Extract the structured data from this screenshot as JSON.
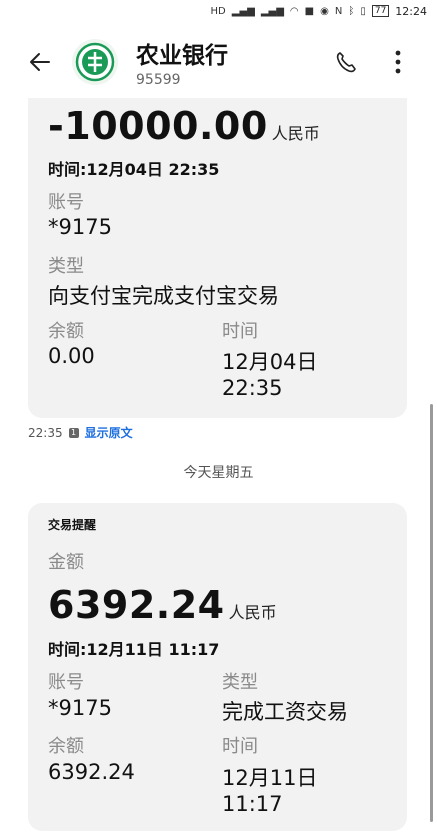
{
  "status_bar": {
    "time": "12:24",
    "battery": "77"
  },
  "header": {
    "title": "农业银行",
    "subtitle": "95599"
  },
  "messages": [
    {
      "amount": "-10000.00",
      "unit": "人民币",
      "time_line": "时间:12月04日 22:35",
      "account_label": "账号",
      "account_value": "*9175",
      "type_label": "类型",
      "type_value": "向支付宝完成支付宝交易",
      "balance_label": "余额",
      "balance_value": "0.00",
      "datetime_label": "时间",
      "datetime_line1": "12月04日",
      "datetime_line2": "22:35"
    },
    {
      "card_title": "交易提醒",
      "amount_label": "金额",
      "amount": "6392.24",
      "unit": "人民币",
      "time_line": "时间:12月11日 11:17",
      "account_label": "账号",
      "account_value": "*9175",
      "type_label": "类型",
      "type_value": "完成工资交易",
      "balance_label": "余额",
      "balance_value": "6392.24",
      "datetime_label": "时间",
      "datetime_line1": "12月11日",
      "datetime_line2": "11:17"
    }
  ],
  "message_meta": {
    "time": "22:35",
    "sim_badge": "1",
    "show_original": "显示原文"
  },
  "day_separator": "今天星期五"
}
